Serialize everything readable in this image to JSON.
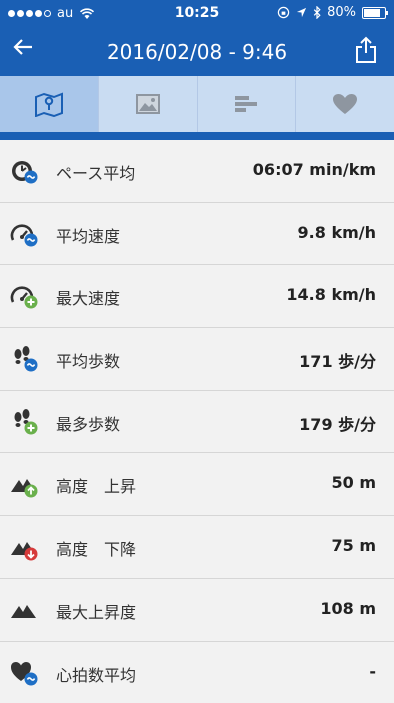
{
  "status_bar": {
    "carrier": "au",
    "time": "10:25",
    "battery": "80%",
    "battery_level": 0.8
  },
  "header": {
    "title": "2016/02/08 - 9:46",
    "back_icon": "arrow-left-icon",
    "share_icon": "share-icon"
  },
  "tabs": [
    {
      "icon": "map-icon",
      "active": true
    },
    {
      "icon": "photo-icon",
      "active": false
    },
    {
      "icon": "bar-chart-icon",
      "active": false
    },
    {
      "icon": "heart-icon",
      "active": false
    }
  ],
  "stats": [
    {
      "label": "ペース平均",
      "value": "06:07 min/km",
      "icon": "pace-average-icon"
    },
    {
      "label": "平均速度",
      "value": "9.8 km/h",
      "icon": "speed-average-icon"
    },
    {
      "label": "最大速度",
      "value": "14.8 km/h",
      "icon": "speed-max-icon"
    },
    {
      "label": "平均歩数",
      "value": "171 歩/分",
      "icon": "steps-average-icon"
    },
    {
      "label": "最多歩数",
      "value": "179 歩/分",
      "icon": "steps-max-icon"
    },
    {
      "label": "高度　上昇",
      "value": "50 m",
      "icon": "elevation-gain-icon"
    },
    {
      "label": "高度　下降",
      "value": "75 m",
      "icon": "elevation-loss-icon"
    },
    {
      "label": "最大上昇度",
      "value": "108 m",
      "icon": "max-elevation-icon"
    },
    {
      "label": "心拍数平均",
      "value": "-",
      "icon": "heart-rate-average-icon"
    }
  ],
  "colors": {
    "primary": "#1a5fb4",
    "tab_bg": "#c9dcf2",
    "accent_blue": "#1f6fc5",
    "accent_green": "#6ab04c",
    "accent_red": "#d63a3a"
  }
}
